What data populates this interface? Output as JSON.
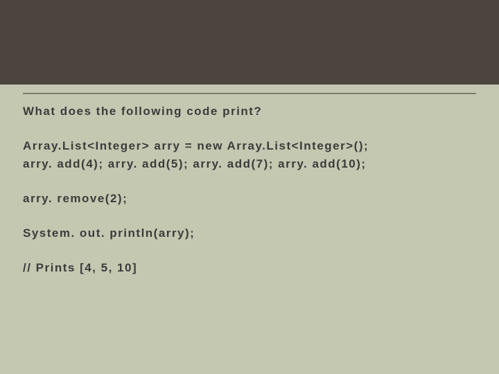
{
  "question": "What does the following code print?",
  "code": {
    "line1": "Array.List<Integer> arry = new Array.List<Integer>();",
    "line2": "arry. add(4); arry. add(5); arry. add(7); arry. add(10);",
    "line3": "arry. remove(2);",
    "line4": "System. out. println(arry);",
    "line5": "// Prints  [4, 5, 10]"
  }
}
